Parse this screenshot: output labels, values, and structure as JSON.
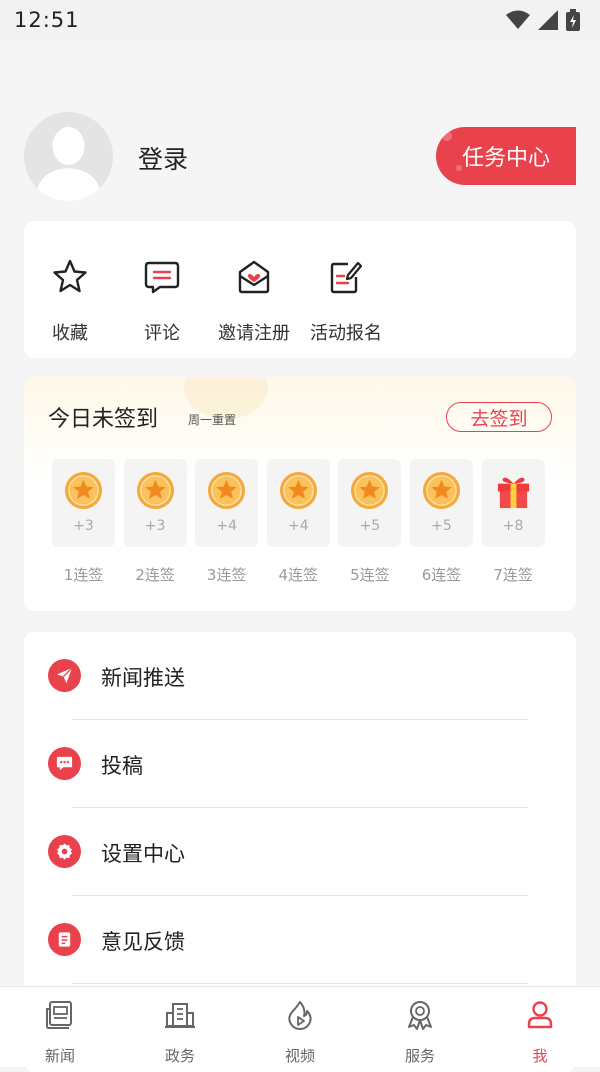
{
  "status_bar": {
    "time": "12:51"
  },
  "profile": {
    "login_label": "登录",
    "task_center_label": "任务中心"
  },
  "quick_actions": [
    {
      "label": "收藏",
      "icon": "star-icon"
    },
    {
      "label": "评论",
      "icon": "comment-icon"
    },
    {
      "label": "邀请注册",
      "icon": "invite-mail-icon"
    },
    {
      "label": "活动报名",
      "icon": "signup-form-icon"
    }
  ],
  "sign_in": {
    "title": "今日未签到",
    "subtitle": "周一重置",
    "button_label": "去签到",
    "days": [
      {
        "points": "+3",
        "label": "1连签",
        "icon": "coin-icon"
      },
      {
        "points": "+3",
        "label": "2连签",
        "icon": "coin-icon"
      },
      {
        "points": "+4",
        "label": "3连签",
        "icon": "coin-icon"
      },
      {
        "points": "+4",
        "label": "4连签",
        "icon": "coin-icon"
      },
      {
        "points": "+5",
        "label": "5连签",
        "icon": "coin-icon"
      },
      {
        "points": "+5",
        "label": "6连签",
        "icon": "coin-icon"
      },
      {
        "points": "+8",
        "label": "7连签",
        "icon": "gift-icon"
      }
    ]
  },
  "menu": [
    {
      "label": "新闻推送",
      "icon": "paper-plane-icon"
    },
    {
      "label": "投稿",
      "icon": "message-icon"
    },
    {
      "label": "设置中心",
      "icon": "gear-icon"
    },
    {
      "label": "意见反馈",
      "icon": "feedback-icon"
    }
  ],
  "bottom_nav": [
    {
      "label": "新闻",
      "icon": "news-icon",
      "active": false
    },
    {
      "label": "政务",
      "icon": "building-icon",
      "active": false
    },
    {
      "label": "视频",
      "icon": "flame-icon",
      "active": false
    },
    {
      "label": "服务",
      "icon": "ribbon-icon",
      "active": false
    },
    {
      "label": "我",
      "icon": "user-icon",
      "active": true
    }
  ],
  "colors": {
    "accent": "#e9424d",
    "coin": "#f0a030",
    "background": "#f5f5f5"
  }
}
